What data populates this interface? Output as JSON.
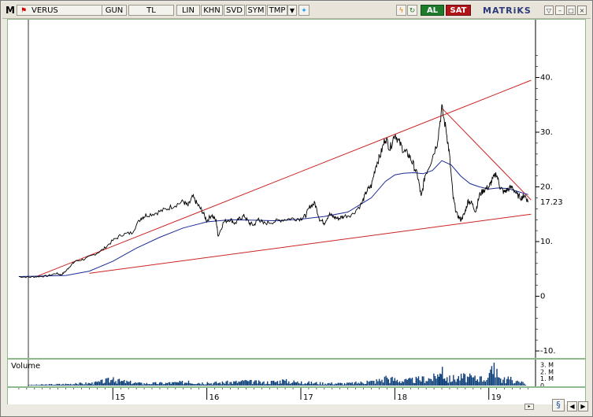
{
  "toolbar": {
    "m_label": "M",
    "symbol": "VERUS",
    "period": "GUN",
    "currency": "TL",
    "scale": "LIN",
    "khn": "KHN",
    "svd": "SVD",
    "sym": "SYM",
    "tmp": "TMP",
    "buy": "AL",
    "sell": "SAT",
    "brand": "MATRiKS"
  },
  "chart_data": {
    "type": "line",
    "title": "",
    "ylabel": "",
    "xlabel": "",
    "y_ticks": [
      "40.",
      "30.",
      "20.",
      "10.",
      "0",
      "-10."
    ],
    "y_tick_values": [
      40,
      30,
      20,
      10,
      0,
      -10
    ],
    "ylim": [
      -11,
      50
    ],
    "x_ticks": [
      "15",
      "16",
      "17",
      "18",
      "19"
    ],
    "last_price_label": "17.23",
    "last_price": 17.23,
    "price_series": [
      [
        2014.0,
        3.6
      ],
      [
        2014.1,
        3.5
      ],
      [
        2014.2,
        3.6
      ],
      [
        2014.3,
        3.7
      ],
      [
        2014.4,
        4.2
      ],
      [
        2014.45,
        3.9
      ],
      [
        2014.5,
        4.6
      ],
      [
        2014.55,
        5.6
      ],
      [
        2014.6,
        6.4
      ],
      [
        2014.7,
        6.8
      ],
      [
        2014.8,
        7.6
      ],
      [
        2014.9,
        8.6
      ],
      [
        2015.0,
        10.2
      ],
      [
        2015.1,
        11.3
      ],
      [
        2015.2,
        11.6
      ],
      [
        2015.3,
        14.3
      ],
      [
        2015.35,
        14.8
      ],
      [
        2015.45,
        15.2
      ],
      [
        2015.55,
        15.8
      ],
      [
        2015.65,
        16.6
      ],
      [
        2015.75,
        17.3
      ],
      [
        2015.8,
        16.5
      ],
      [
        2015.85,
        18.2
      ],
      [
        2015.9,
        16.8
      ],
      [
        2015.95,
        15.6
      ],
      [
        2016.0,
        13.8
      ],
      [
        2016.05,
        14.9
      ],
      [
        2016.1,
        13.7
      ],
      [
        2016.12,
        11.0
      ],
      [
        2016.18,
        13.6
      ],
      [
        2016.25,
        14.1
      ],
      [
        2016.3,
        13.3
      ],
      [
        2016.35,
        14.2
      ],
      [
        2016.4,
        14.7
      ],
      [
        2016.45,
        13.4
      ],
      [
        2016.5,
        13.0
      ],
      [
        2016.55,
        14.2
      ],
      [
        2016.6,
        13.3
      ],
      [
        2016.7,
        13.6
      ],
      [
        2016.8,
        14.0
      ],
      [
        2016.9,
        14.2
      ],
      [
        2017.0,
        14.2
      ],
      [
        2017.05,
        14.7
      ],
      [
        2017.1,
        16.5
      ],
      [
        2017.15,
        17.0
      ],
      [
        2017.2,
        14.1
      ],
      [
        2017.25,
        13.4
      ],
      [
        2017.3,
        15.0
      ],
      [
        2017.35,
        14.5
      ],
      [
        2017.4,
        14.2
      ],
      [
        2017.45,
        14.6
      ],
      [
        2017.55,
        15.0
      ],
      [
        2017.65,
        17.0
      ],
      [
        2017.7,
        19.2
      ],
      [
        2017.75,
        20.2
      ],
      [
        2017.8,
        24.0
      ],
      [
        2017.85,
        26.0
      ],
      [
        2017.9,
        29.0
      ],
      [
        2017.95,
        27.0
      ],
      [
        2018.0,
        29.8
      ],
      [
        2018.05,
        28.0
      ],
      [
        2018.1,
        26.5
      ],
      [
        2018.15,
        25.8
      ],
      [
        2018.2,
        24.0
      ],
      [
        2018.25,
        21.5
      ],
      [
        2018.28,
        18.0
      ],
      [
        2018.32,
        22.0
      ],
      [
        2018.38,
        24.5
      ],
      [
        2018.45,
        28.0
      ],
      [
        2018.5,
        34.4
      ],
      [
        2018.55,
        30.0
      ],
      [
        2018.58,
        26.0
      ],
      [
        2018.62,
        18.0
      ],
      [
        2018.66,
        15.0
      ],
      [
        2018.7,
        14.0
      ],
      [
        2018.74,
        15.0
      ],
      [
        2018.78,
        17.5
      ],
      [
        2018.82,
        17.0
      ],
      [
        2018.86,
        15.5
      ],
      [
        2018.9,
        18.5
      ],
      [
        2018.95,
        19.5
      ],
      [
        2019.0,
        20.0
      ],
      [
        2019.03,
        21.0
      ],
      [
        2019.08,
        22.5
      ],
      [
        2019.12,
        20.0
      ],
      [
        2019.16,
        19.0
      ],
      [
        2019.2,
        19.5
      ],
      [
        2019.25,
        20.0
      ],
      [
        2019.3,
        18.5
      ],
      [
        2019.35,
        18.0
      ],
      [
        2019.38,
        18.5
      ],
      [
        2019.42,
        17.23
      ]
    ],
    "moving_average": [
      [
        2014.0,
        3.6
      ],
      [
        2014.5,
        3.8
      ],
      [
        2014.75,
        4.6
      ],
      [
        2015.0,
        6.4
      ],
      [
        2015.25,
        8.8
      ],
      [
        2015.5,
        10.8
      ],
      [
        2015.75,
        12.5
      ],
      [
        2016.0,
        13.6
      ],
      [
        2016.25,
        14.0
      ],
      [
        2016.5,
        13.9
      ],
      [
        2016.75,
        13.8
      ],
      [
        2017.0,
        14.1
      ],
      [
        2017.25,
        14.6
      ],
      [
        2017.5,
        15.4
      ],
      [
        2017.75,
        18.0
      ],
      [
        2017.9,
        21.0
      ],
      [
        2018.0,
        22.2
      ],
      [
        2018.1,
        22.5
      ],
      [
        2018.2,
        22.6
      ],
      [
        2018.3,
        22.4
      ],
      [
        2018.4,
        23.0
      ],
      [
        2018.5,
        24.8
      ],
      [
        2018.6,
        24.0
      ],
      [
        2018.7,
        22.0
      ],
      [
        2018.8,
        20.6
      ],
      [
        2018.9,
        20.0
      ],
      [
        2019.0,
        19.6
      ],
      [
        2019.1,
        19.8
      ],
      [
        2019.2,
        19.7
      ],
      [
        2019.3,
        19.2
      ],
      [
        2019.42,
        18.6
      ]
    ],
    "trendlines": [
      {
        "from": [
          2014.2,
          3.7
        ],
        "to": [
          2019.45,
          39.5
        ],
        "label": "upper"
      },
      {
        "from": [
          2014.75,
          4.2
        ],
        "to": [
          2019.45,
          15.0
        ],
        "label": "lower"
      },
      {
        "from": [
          2018.5,
          34.4
        ],
        "to": [
          2019.45,
          17.6
        ],
        "label": "resistance"
      }
    ],
    "volume": [
      [
        2014.1,
        0.1
      ],
      [
        2014.6,
        0.35
      ],
      [
        2014.8,
        0.5
      ],
      [
        2015.0,
        1.2
      ],
      [
        2015.05,
        0.9
      ],
      [
        2015.3,
        0.4
      ],
      [
        2015.6,
        0.5
      ],
      [
        2015.8,
        0.7
      ],
      [
        2016.0,
        0.5
      ],
      [
        2016.2,
        0.6
      ],
      [
        2016.4,
        0.8
      ],
      [
        2016.6,
        0.6
      ],
      [
        2016.8,
        0.9
      ],
      [
        2017.0,
        0.6
      ],
      [
        2017.2,
        0.5
      ],
      [
        2017.5,
        0.4
      ],
      [
        2017.7,
        0.7
      ],
      [
        2017.8,
        0.9
      ],
      [
        2017.9,
        1.4
      ],
      [
        2018.1,
        0.9
      ],
      [
        2018.3,
        1.3
      ],
      [
        2018.45,
        1.6
      ],
      [
        2018.5,
        2.7
      ],
      [
        2018.55,
        1.2
      ],
      [
        2018.7,
        1.7
      ],
      [
        2018.9,
        1.3
      ],
      [
        2019.0,
        1.8
      ],
      [
        2019.05,
        3.3
      ],
      [
        2019.08,
        2.4
      ],
      [
        2019.12,
        1.0
      ],
      [
        2019.2,
        1.3
      ],
      [
        2019.3,
        0.7
      ],
      [
        2019.4,
        0.4
      ]
    ],
    "volume_label": "Volume",
    "volume_ticks": [
      "3. M",
      "2. M",
      "1. M",
      "0"
    ],
    "volume_tick_values": [
      3,
      2,
      1,
      0
    ],
    "colors": {
      "price": "#000000",
      "ma": "#1b2a9a",
      "trend": "#cc2222",
      "volume": "#0d3f7a",
      "frame": "#8fb98f"
    }
  }
}
